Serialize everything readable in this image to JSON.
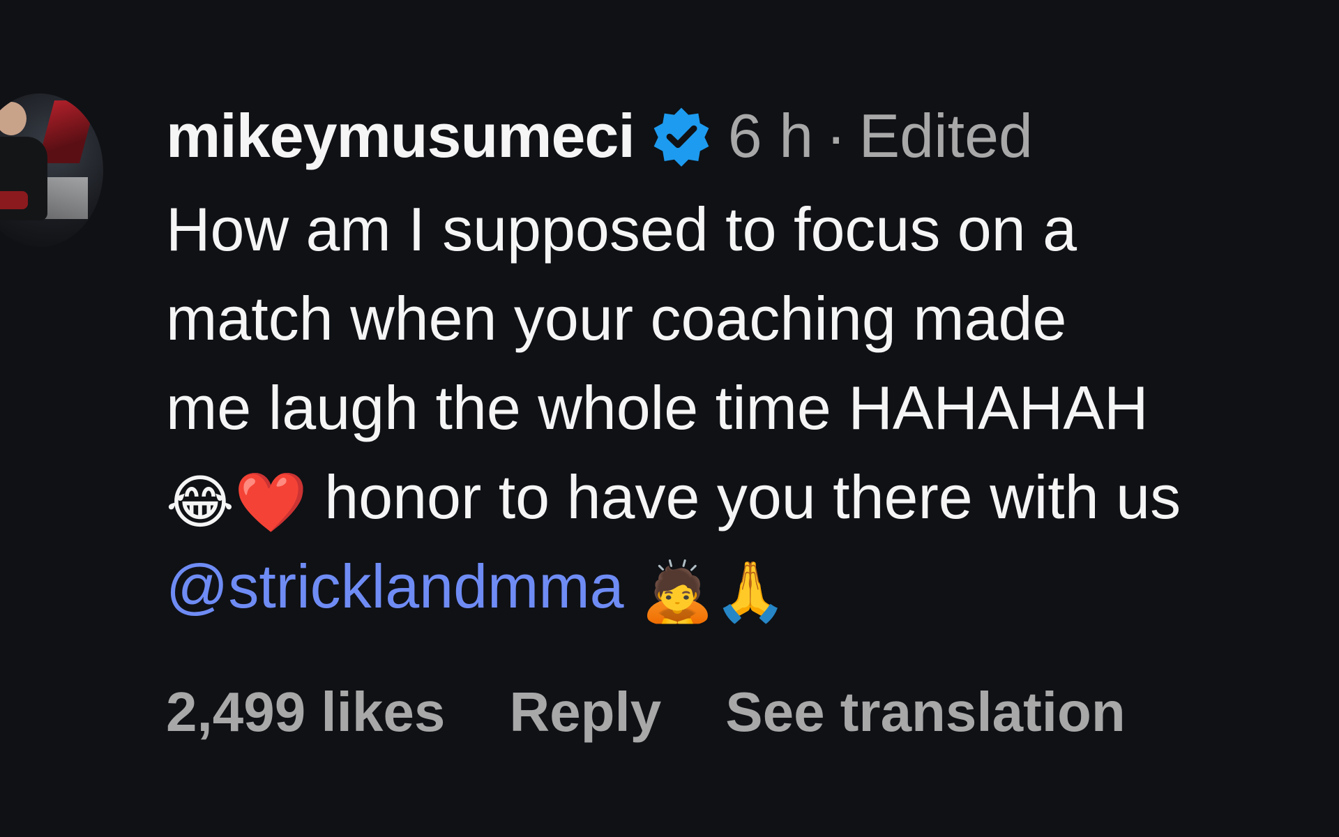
{
  "comment": {
    "username": "mikeymusumeci",
    "verified_icon": "verified-badge-icon",
    "timestamp": "6 h",
    "separator": "·",
    "edited_label": "Edited",
    "body_lines": [
      "How am I supposed to focus on a",
      "match when your coaching made",
      "me laugh the whole time HAHAHAH",
      "honor to have you there with us"
    ],
    "emoji_laugh": "😂",
    "emoji_heart": "❤️",
    "mention": "@stricklandmma",
    "emoji_bow": "🙇",
    "emoji_pray": "🙏",
    "likes": "2,499 likes",
    "reply_label": "Reply",
    "translate_label": "See translation",
    "colors": {
      "background": "#0f1115",
      "text": "#f5f5f5",
      "muted": "#a8a8a8",
      "mention": "#6f8cf5",
      "verified": "#1d9bf0"
    }
  }
}
